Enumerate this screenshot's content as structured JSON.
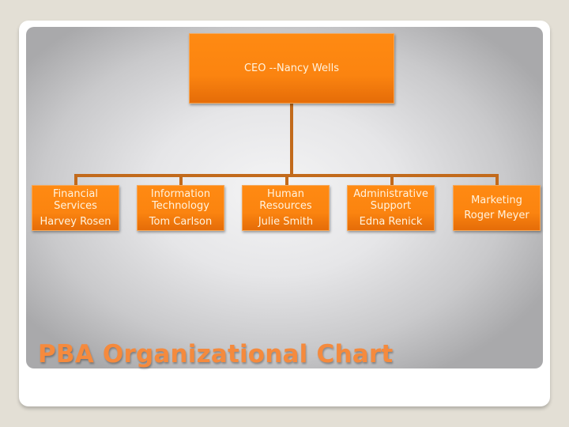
{
  "slide": {
    "title": "PBA Organizational Chart"
  },
  "org_chart": {
    "root": {
      "label": "CEO --Nancy Wells"
    },
    "departments": [
      {
        "dept_line1": "Financial",
        "dept_line2": "Services",
        "head": "Harvey Rosen"
      },
      {
        "dept_line1": "Information",
        "dept_line2": "Technology",
        "head": "Tom Carlson"
      },
      {
        "dept_line1": "Human",
        "dept_line2": "Resources",
        "head": "Julie Smith"
      },
      {
        "dept_line1": "Administrative",
        "dept_line2": "Support",
        "head": "Edna Renick"
      },
      {
        "dept_line1": "Marketing",
        "dept_line2": "",
        "head": "Roger Meyer"
      }
    ]
  },
  "colors": {
    "box_orange": "#fb8410",
    "connector": "#c26a1b",
    "title_orange": "#f58a3d"
  }
}
